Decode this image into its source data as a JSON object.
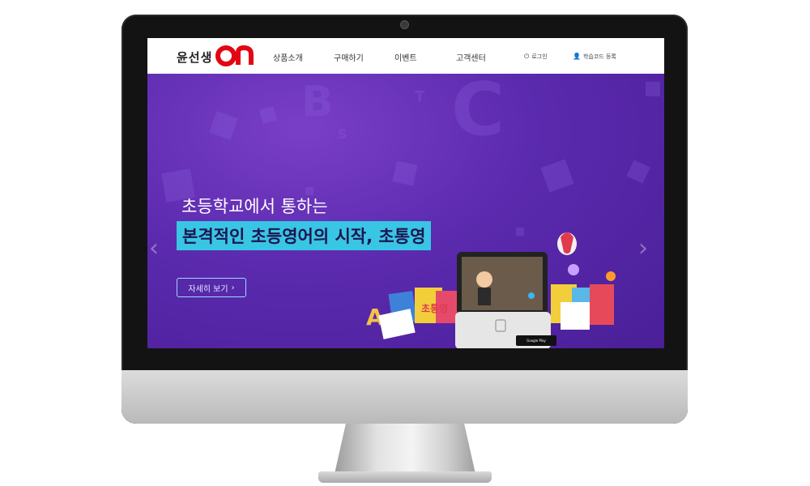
{
  "brand": {
    "name": "윤선생",
    "logo": "On"
  },
  "nav": {
    "items": [
      "상품소개",
      "구매하기",
      "이벤트",
      "고객센터"
    ],
    "login": "로그인",
    "register": "학습코드 등록"
  },
  "hero": {
    "line1": "초등학교에서 통하는",
    "line2": "본격적인 초등영어의 시작, 초통영",
    "button_label": "자세히 보기",
    "product_box_label": "초통영"
  },
  "store_badge": "Google Play",
  "colors": {
    "hero_bg": "#5b2aae",
    "highlight": "#39c5e4",
    "logo_red": "#e30613"
  },
  "icons": [
    "power-icon",
    "user-icon",
    "chevron-left-icon",
    "chevron-right-icon",
    "chevron-right-small-icon"
  ]
}
